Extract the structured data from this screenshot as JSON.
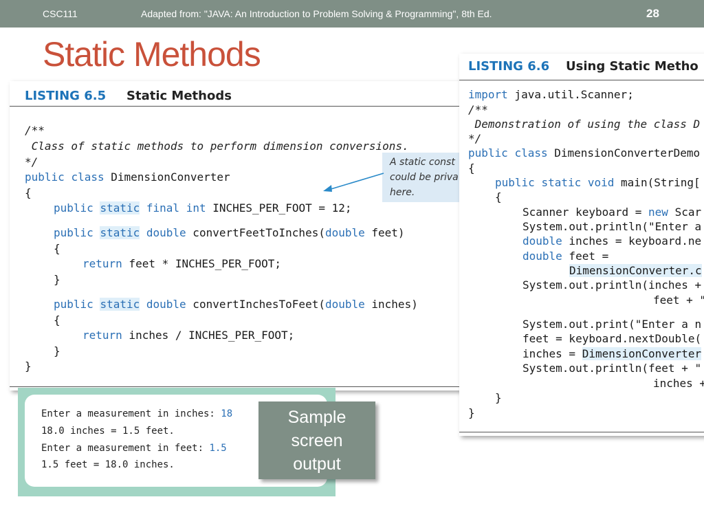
{
  "header": {
    "course": "CSC111",
    "source": "Adapted from: \"JAVA: An Introduction to Problem Solving & Programming\", 8th Ed.",
    "slide_number": "28"
  },
  "slide_title": "Static Methods",
  "listing_65": {
    "number": "LISTING 6.5",
    "name": "Static Methods",
    "code": {
      "c1": "/**",
      "c2": " Class of static methods to perform dimension conversions.",
      "c3": "*/",
      "public": "public",
      "class": "class",
      "static": "static",
      "final": "final",
      "int": "int",
      "double": "double",
      "return": "return",
      "class_name": " DimensionConverter",
      "open_brace": "{",
      "close_brace": "}",
      "const_rest": " INCHES_PER_FOOT = 12;",
      "m1_name": " convertFeetToInches(",
      "m1_param": " feet)",
      "m1_body": " feet * INCHES_PER_FOOT;",
      "m2_name": " convertInchesToFeet(",
      "m2_param": " inches)",
      "m2_body": " inches / INCHES_PER_FOOT;"
    },
    "callout": {
      "line1": "A static const",
      "line2": "could be priva",
      "line3": "here."
    }
  },
  "listing_66": {
    "number": "LISTING 6.6",
    "name": "Using Static Metho",
    "code": {
      "import": "import",
      "import_rest": " java.util.Scanner;",
      "c1": "/**",
      "c2": " Demonstration of using the class D",
      "c3": "*/",
      "public": "public",
      "class": "class",
      "static": "static",
      "void": "void",
      "double": "double",
      "new": "new",
      "class_name": " DimensionConverterDemo",
      "open_brace": "{",
      "close_brace": "}",
      "main_rest": " main(String[",
      "scanner_line": "Scanner keyboard = ",
      "scanner_rest": " Scar",
      "println1": "System.out.println(\"Enter a",
      "inches_decl": " inches = keyboard.ne",
      "feet_decl": " feet =",
      "dc_call": "DimensionConverter.c",
      "println2": "System.out.println(inches +",
      "feet_plus": "feet + \"",
      "print3": "System.out.print(\"Enter a n",
      "feet_assign": "feet = keyboard.nextDouble(",
      "inches_assign": "inches = ",
      "dc_call2": "DimensionConverter",
      "println4": "System.out.println(feet + \"",
      "inches_tail": "inches +"
    }
  },
  "output": {
    "line1_prompt": "Enter a measurement in inches: ",
    "line1_input": "18",
    "line2": "18.0 inches = 1.5 feet.",
    "line3_prompt": "Enter a measurement in feet: ",
    "line3_input": "1.5",
    "line4": "1.5 feet = 18.0 inches."
  },
  "sample_label": {
    "line1": "Sample",
    "line2": "screen",
    "line3": "output"
  },
  "colors": {
    "header_bar": "#7f8f86",
    "title": "#c9513a",
    "listing_number": "#1d73b8",
    "keyword": "#2a6fb5",
    "static_highlight": "#dfeff9",
    "output_border": "#a2d5c4"
  }
}
